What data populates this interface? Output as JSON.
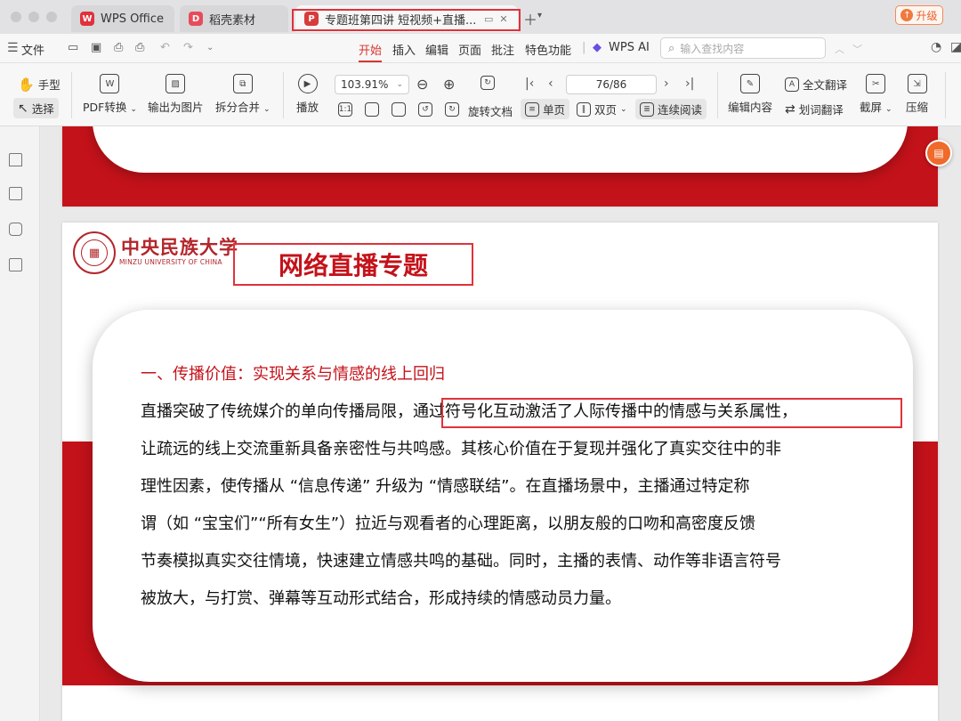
{
  "tabs": [
    {
      "label": "WPS Office",
      "logo": "W",
      "color": "#e0323b"
    },
    {
      "label": "稻壳素材",
      "logo": "D",
      "color": "#e74c5a"
    },
    {
      "label": "专题班第四讲 短视频+直播...",
      "logo": "P",
      "color": "#d83b3b"
    }
  ],
  "upgrade_label": "升级",
  "menu": {
    "file": "文件",
    "items": [
      "开始",
      "插入",
      "编辑",
      "页面",
      "批注",
      "特色功能"
    ],
    "active": "开始",
    "ai": "WPS AI",
    "search_placeholder": "输入查找内容"
  },
  "ribbon": {
    "hand": "手型",
    "select": "选择",
    "pdf_convert": "PDF转换",
    "export_image": "输出为图片",
    "split_merge": "拆分合并",
    "play": "播放",
    "zoom": "103.91%",
    "rotate": "旋转文档",
    "single_page": "单页",
    "double_page": "双页",
    "continuous": "连续阅读",
    "page_indicator": "76/86",
    "edit_content": "编辑内容",
    "full_translate": "全文翻译",
    "word_translate": "划词翻译",
    "screenshot": "截屏",
    "compress": "压缩"
  },
  "doc": {
    "uni_name_cn": "中央民族大学",
    "uni_name_en": "MINZU UNIVERSITY OF CHINA",
    "slide_title": "网络直播专题",
    "heading": "一、传播价值：实现关系与情感的线上回归",
    "lines": [
      "直播突破了传统媒介的单向传播局限，通过符号化互动激活了人际传播中的情感与关系属性，",
      "让疏远的线上交流重新具备亲密性与共鸣感。其核心价值在于复现并强化了真实交往中的非",
      "理性因素，使传播从 “信息传递” 升级为 “情感联结”。在直播场景中，主播通过特定称",
      "谓（如 “宝宝们”“所有女生”）拉近与观看者的心理距离，以朋友般的口吻和高密度反馈",
      "节奏模拟真实交往情境，快速建立情感共鸣的基础。同时，主播的表情、动作等非语言符号",
      "被放大，与打赏、弹幕等互动形式结合，形成持续的情感动员力量。"
    ]
  },
  "colors": {
    "brand_red": "#c4121a",
    "annotation_red": "#e0323b"
  }
}
